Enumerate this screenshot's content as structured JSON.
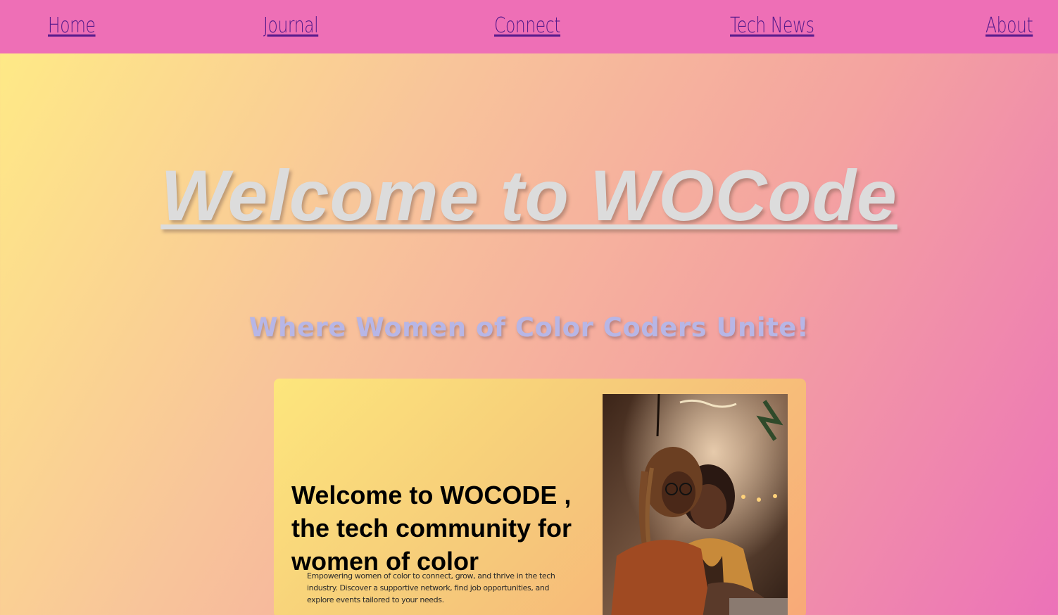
{
  "nav": {
    "home": "Home",
    "journal": "Journal",
    "connect": "Connect",
    "tech_news": "Tech News",
    "about": "About"
  },
  "hero": {
    "title": "Welcome to WOCode",
    "subtitle": "Where Women of Color Coders Unite!"
  },
  "card": {
    "heading": "Welcome to WOCODE , the tech community for women of color",
    "description": "Empowering women of color to connect, grow, and thrive in the tech industry. Discover a supportive network, find job opportunities, and explore events tailored to your needs.",
    "image_label": "two women of color working together at a laptop"
  },
  "colors": {
    "nav_background": "#ee6fb6",
    "link": "#551a8b",
    "title": "#dcdcdc",
    "subtitle": "#b7b6e6"
  }
}
